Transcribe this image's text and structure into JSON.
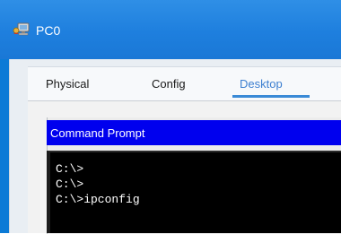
{
  "window": {
    "title": "PC0",
    "icon": "pc-icon"
  },
  "tabs": [
    {
      "label": "Physical",
      "active": false
    },
    {
      "label": "Config",
      "active": false
    },
    {
      "label": "Desktop",
      "active": true
    }
  ],
  "command_prompt": {
    "title": "Command Prompt",
    "lines": [
      "C:\\>",
      "C:\\>",
      "C:\\>ipconfig"
    ]
  },
  "colors": {
    "titlebar": "#1e7fde",
    "cmd_header": "#0000ee",
    "active_tab_text": "#3d7fd0",
    "terminal_bg": "#000000",
    "terminal_text": "#ffffff"
  }
}
